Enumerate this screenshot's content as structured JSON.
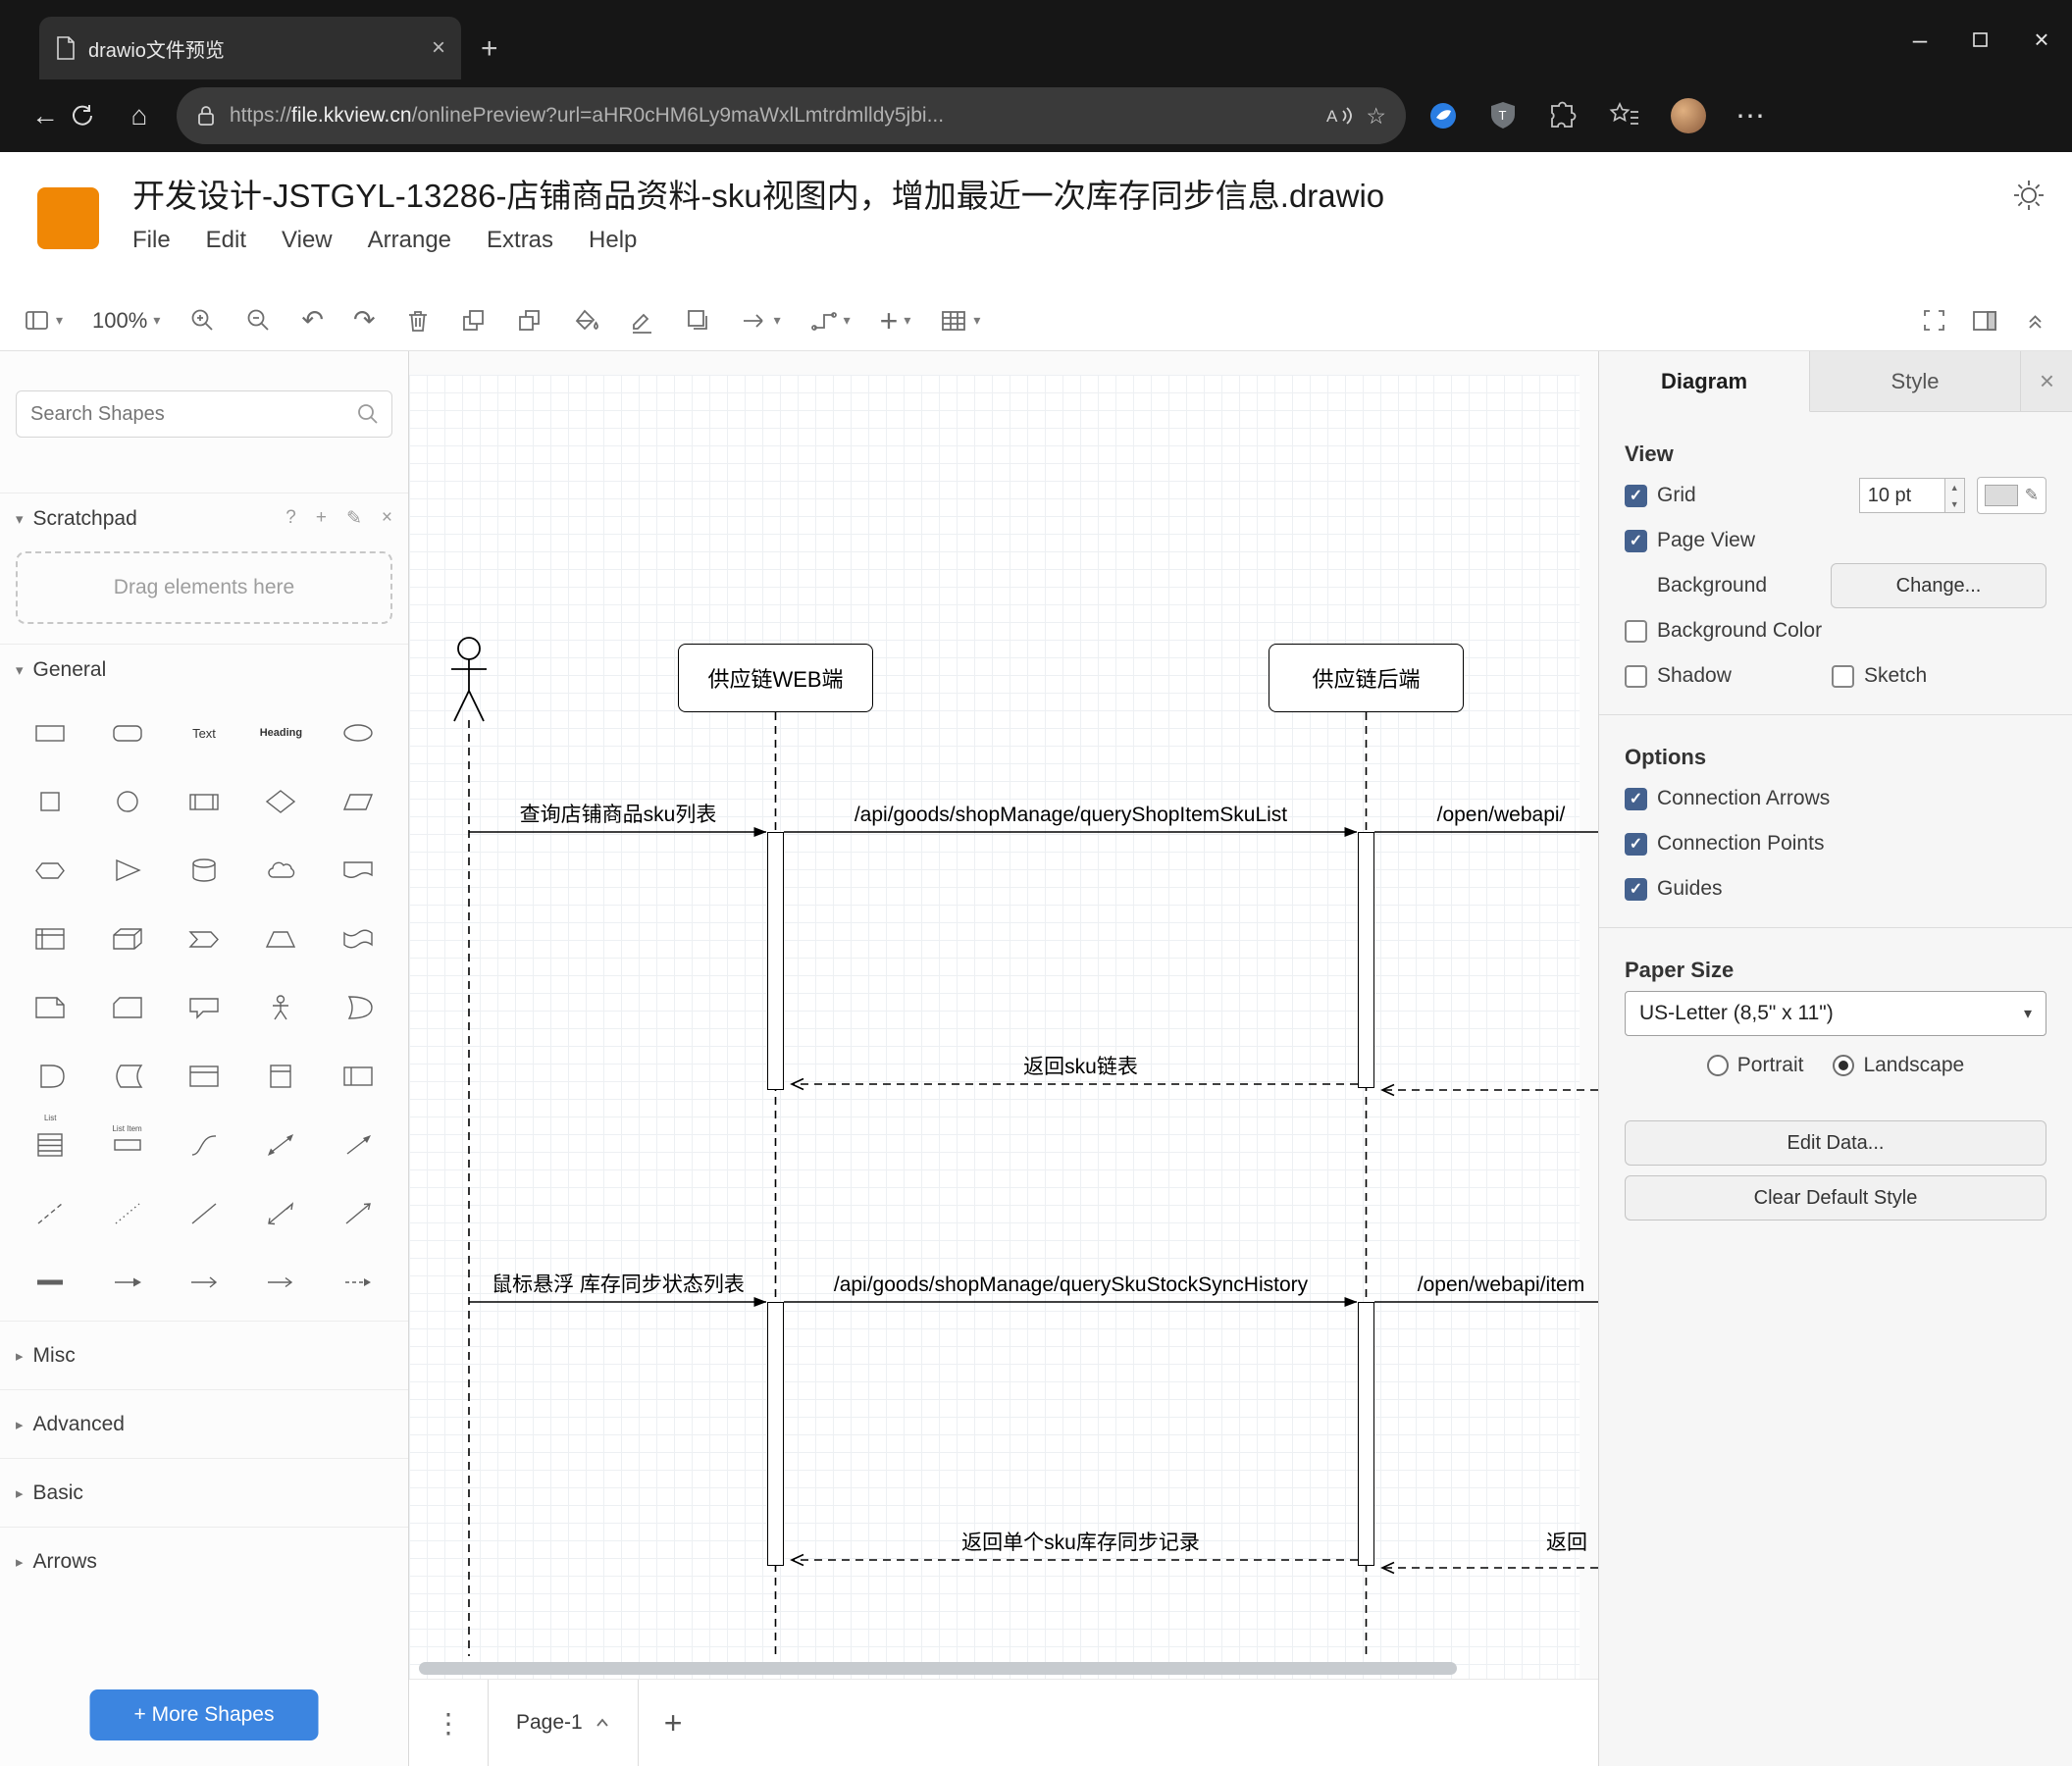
{
  "colors": {
    "logo_orange": "#f08705",
    "accent_blue": "#3c85e0",
    "chrome_bg": "#161616"
  },
  "icons": {
    "close": "×",
    "plus": "+",
    "minimize": "–",
    "more_horizontal": "⋯",
    "more_vertical": "⋮",
    "caret_down": "▾",
    "caret_right": "▸",
    "pencil": "✎",
    "question": "?",
    "undo": "↶",
    "redo": "↷",
    "back_arrow": "←",
    "home": "⌂",
    "star": "☆"
  },
  "browser": {
    "tab_title": "drawio文件预览",
    "url": {
      "scheme": "https://",
      "host": "file.kkview.cn",
      "path": "/onlinePreview?url=aHR0cHM6Ly9maWxlLmtrdmlldy5jbi..."
    }
  },
  "app": {
    "title": "开发设计-JSTGYL-13286-店铺商品资料-sku视图内，增加最近一次库存同步信息.drawio",
    "menus": [
      "File",
      "Edit",
      "View",
      "Arrange",
      "Extras",
      "Help"
    ],
    "zoom_level": "100%"
  },
  "sidebar": {
    "search_placeholder": "Search Shapes",
    "scratchpad_label": "Scratchpad",
    "scratchpad_hint": "Drag elements here",
    "sections": {
      "general": "General",
      "misc": "Misc",
      "advanced": "Advanced",
      "basic": "Basic",
      "arrows": "Arrows"
    },
    "shape_labels": {
      "text": "Text",
      "heading": "Heading",
      "list": "List",
      "list_item": "List Item"
    },
    "shapes": [
      "rectangle",
      "rounded-rectangle",
      "text",
      "textbox",
      "ellipse",
      "square",
      "circle",
      "process",
      "diamond",
      "parallelogram",
      "hexagon",
      "triangle",
      "cylinder",
      "cloud",
      "document",
      "internal-storage",
      "cube",
      "step",
      "trapezoid",
      "tape",
      "note",
      "card",
      "callout",
      "actor",
      "or",
      "and",
      "data-storage",
      "container",
      "vertical-container",
      "horizontal-container",
      "list",
      "list-item",
      "curve",
      "bidirectional-arrow",
      "arrow",
      "dashed-line",
      "dotted-line",
      "line",
      "bidirectional-connector",
      "directional-connector",
      "link",
      "arrow-right",
      "simple-arrow",
      "thin-arrow",
      "dashed-edge-arrow"
    ],
    "more_shapes_label": "+ More Shapes"
  },
  "canvas": {
    "lifelines": [
      "供应链WEB端",
      "供应链后端"
    ],
    "messages": {
      "query_sku_list": "查询店铺商品sku列表",
      "api_query_shop_item_sku_list": "/api/goods/shopManage/queryShopItemSkuList",
      "open_webapi": "/open/webapi/",
      "return_sku_list": "返回sku链表",
      "hover_stock_sync": "鼠标悬浮 库存同步状态列表",
      "api_query_sku_stock_sync_history": "/api/goods/shopManage/querySkuStockSyncHistory",
      "open_webapi_item": "/open/webapi/item",
      "return_single_sku": "返回单个sku库存同步记录",
      "return_partial": "返回"
    }
  },
  "panel": {
    "tab_diagram": "Diagram",
    "tab_style": "Style",
    "view_heading": "View",
    "grid_label": "Grid",
    "grid_size_value": "10 pt",
    "page_view_label": "Page View",
    "background_label": "Background",
    "change_button": "Change...",
    "background_color_label": "Background Color",
    "shadow_label": "Shadow",
    "sketch_label": "Sketch",
    "options_heading": "Options",
    "connection_arrows_label": "Connection Arrows",
    "connection_points_label": "Connection Points",
    "guides_label": "Guides",
    "paper_heading": "Paper Size",
    "paper_size_value": "US-Letter (8,5\" x 11\")",
    "portrait_label": "Portrait",
    "landscape_label": "Landscape",
    "edit_data_button": "Edit Data...",
    "clear_default_style_button": "Clear Default Style"
  },
  "footer": {
    "page_tab": "Page-1"
  }
}
